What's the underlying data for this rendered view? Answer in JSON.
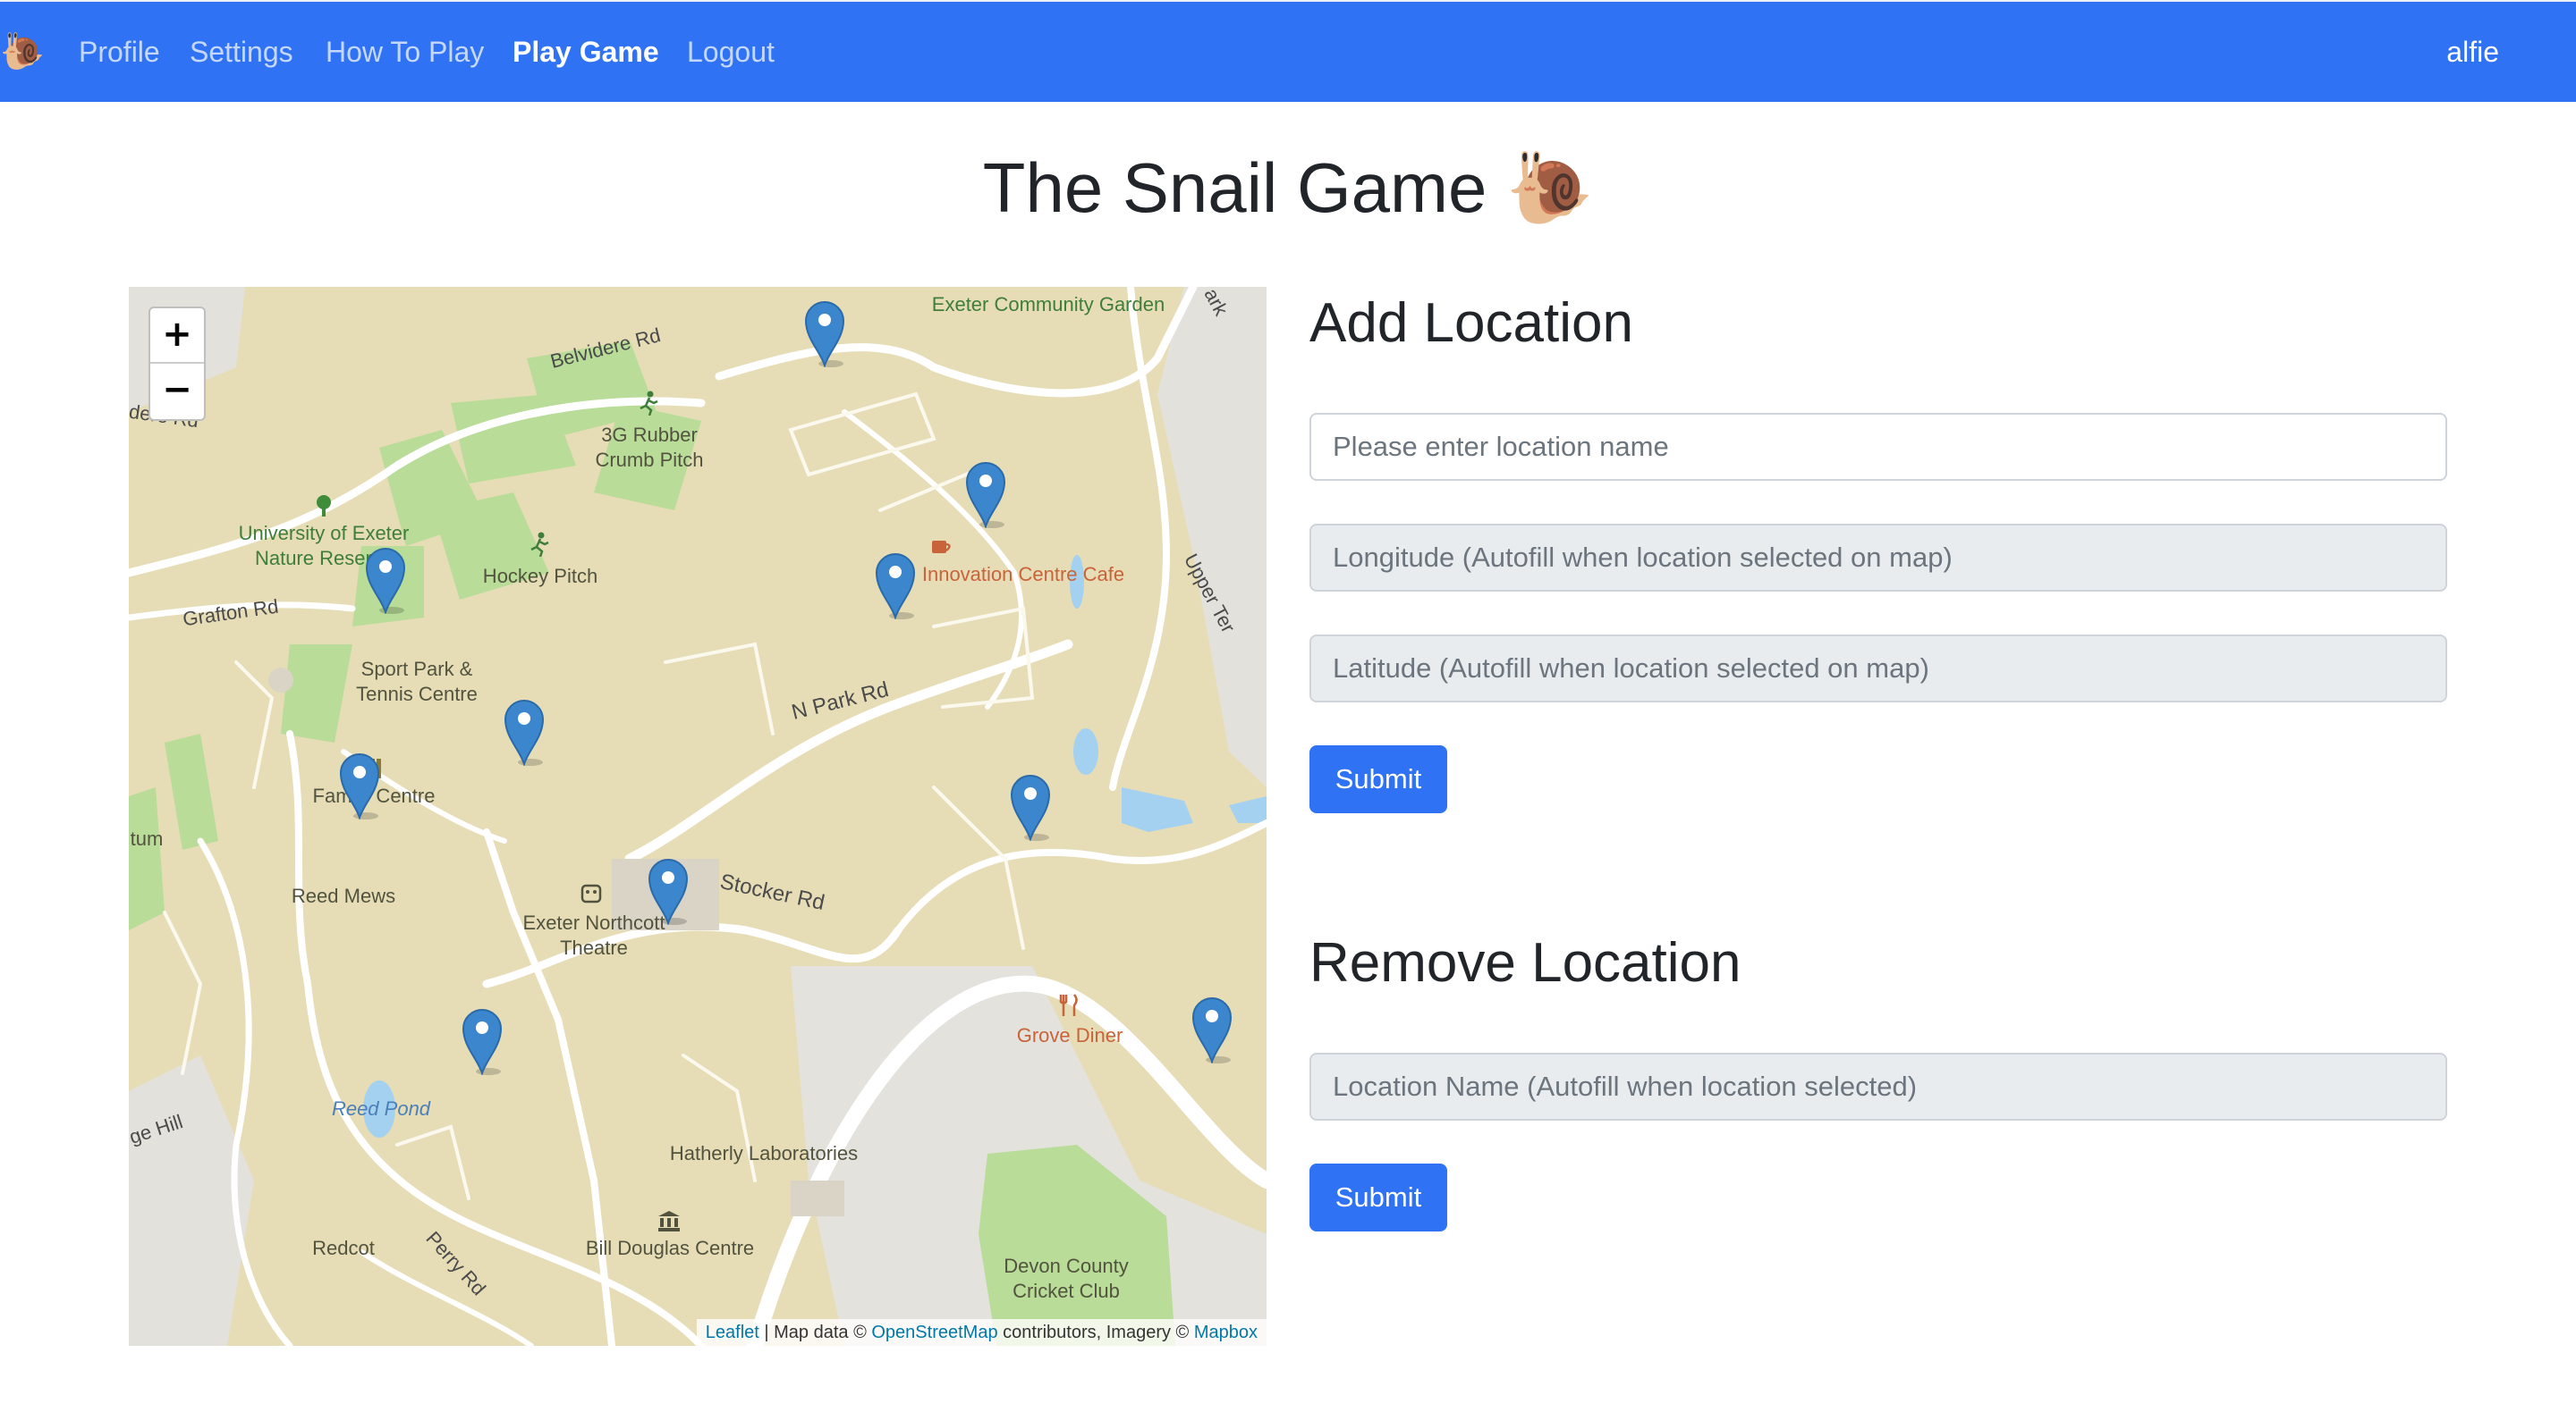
{
  "navbar": {
    "brand_icon": "🐌",
    "links": [
      "Profile",
      "Settings",
      "How To Play",
      "Play Game",
      "Logout"
    ],
    "active_link": "Play Game",
    "user": "alfie",
    "background": "#2f72f4"
  },
  "page": {
    "title": "The Snail Game 🐌"
  },
  "map": {
    "zoom_in": "+",
    "zoom_out": "−",
    "labels": {
      "community_garden": "Exeter Community Garden",
      "rubber_pitch": "3G Rubber Crumb Pitch",
      "nature_reserve": "University of Exeter Nature Reserve",
      "hockey_pitch": "Hockey Pitch",
      "innovation_cafe": "Innovation Centre Cafe",
      "sport_park": "Sport Park & Tennis Centre",
      "family_centre": "Family Centre",
      "reed_mews": "Reed Mews",
      "northcott": "Exeter Northcott Theatre",
      "grove_diner": "Grove Diner",
      "reed_pond": "Reed Pond",
      "hatherly": "Hatherly Laboratories",
      "redcot": "Redcot",
      "bill_douglas": "Bill Douglas Centre",
      "cricket_club": "Devon County Cricket Club",
      "tum": "tum"
    },
    "roads": {
      "belvidere": "Belvidere Rd",
      "belvidere_left": "dere Rd",
      "grafton": "Grafton Rd",
      "n_park": "N Park Rd",
      "stocker": "Stocker Rd",
      "upper_ter": "Upper Ter",
      "perry": "Perry Rd",
      "ge_hill": "ge Hill",
      "ark": "ark"
    },
    "marker_color": "#3b86cc",
    "marker_count": 11,
    "attribution": {
      "leaflet": "Leaflet",
      "sep1": " | Map data © ",
      "osm": "OpenStreetMap",
      "sep2": " contributors, Imagery © ",
      "mapbox": "Mapbox"
    }
  },
  "add_location": {
    "title": "Add Location",
    "name_placeholder": "Please enter location name",
    "longitude_placeholder": "Longitude (Autofill when location selected on map)",
    "latitude_placeholder": "Latitude (Autofill when location selected on map)",
    "submit": "Submit"
  },
  "remove_location": {
    "title": "Remove Location",
    "name_placeholder": "Location Name (Autofill when location selected)",
    "submit": "Submit"
  }
}
